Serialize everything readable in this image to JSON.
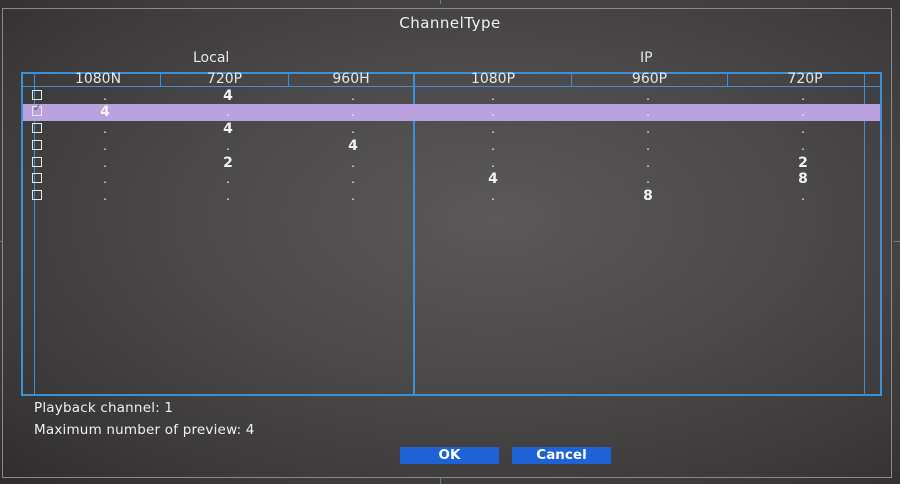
{
  "dialog": {
    "title": "ChannelType"
  },
  "groups": {
    "local": "Local",
    "ip": "IP"
  },
  "columns": {
    "local": [
      "1080N",
      "720P",
      "960H"
    ],
    "ip": [
      "1080P",
      "960P",
      "720P"
    ]
  },
  "rows": [
    {
      "checked": false,
      "selected": false,
      "values": [
        ".",
        "4",
        ".",
        ".",
        ".",
        "."
      ]
    },
    {
      "checked": true,
      "selected": true,
      "values": [
        "4",
        ".",
        ".",
        ".",
        ".",
        "."
      ]
    },
    {
      "checked": false,
      "selected": false,
      "values": [
        ".",
        "4",
        ".",
        ".",
        ".",
        "."
      ]
    },
    {
      "checked": false,
      "selected": false,
      "values": [
        ".",
        ".",
        "4",
        ".",
        ".",
        "."
      ]
    },
    {
      "checked": false,
      "selected": false,
      "values": [
        ".",
        "2",
        ".",
        ".",
        ".",
        "2"
      ]
    },
    {
      "checked": false,
      "selected": false,
      "values": [
        ".",
        ".",
        ".",
        "4",
        ".",
        "8"
      ]
    },
    {
      "checked": false,
      "selected": false,
      "values": [
        ".",
        ".",
        ".",
        ".",
        "8",
        "."
      ]
    }
  ],
  "status": {
    "playback": "Playback channel: 1",
    "max_preview": "Maximum number of preview: 4"
  },
  "buttons": {
    "ok": "OK",
    "cancel": "Cancel"
  },
  "colors": {
    "accent": "#3d8fd6",
    "selection": "#b9a2dd",
    "button": "#1d63d6"
  }
}
